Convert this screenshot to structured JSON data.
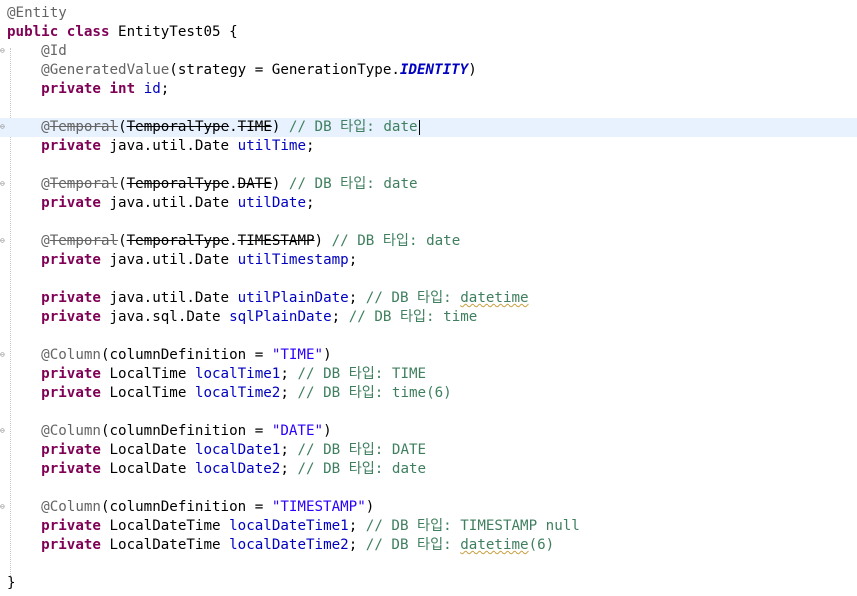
{
  "code": {
    "entity_annotation": "@Entity",
    "class_decl_kw": "public class",
    "class_name": "EntityTest05",
    "open_brace": " {",
    "close_brace": "}",
    "id_annotation": "@Id",
    "generated_value": "@GeneratedValue",
    "strategy_text": "(strategy = GenerationType.",
    "identity": "IDENTITY",
    "close_paren": ")",
    "private_kw": "private",
    "int_kw": "int",
    "id_field": "id",
    "semicolon": ";",
    "at_sign": "@",
    "temporal": "Temporal",
    "open_paren": "(",
    "temporal_type": "TemporalType",
    "dot": ".",
    "time_const": "TIME",
    "date_const": "DATE",
    "timestamp_const": "TIMESTAMP",
    "java_util_date": "java.util.Date",
    "java_sql_date": "java.sql.Date",
    "util_time": "utilTime",
    "util_date": "utilDate",
    "util_timestamp": "utilTimestamp",
    "util_plain_date": "utilPlainDate",
    "sql_plain_date": "sqlPlainDate",
    "column_annotation": "@Column",
    "column_def_prefix": "(columnDefinition = ",
    "time_str": "\"TIME\"",
    "date_str": "\"DATE\"",
    "timestamp_str": "\"TIMESTAMP\"",
    "local_time_type": "LocalTime",
    "local_date_type": "LocalDate",
    "local_datetime_type": "LocalDateTime",
    "local_time1": "localTime1",
    "local_time2": "localTime2",
    "local_date1": "localDate1",
    "local_date2": "localDate2",
    "local_datetime1": "localDateTime1",
    "local_datetime2": "localDateTime2",
    "comment_prefix": "// DB 타입: ",
    "c_date": "date",
    "c_datetime": "datetime",
    "c_time": "time",
    "c_TIME": "TIME",
    "c_time6": "time(6)",
    "c_DATE": "DATE",
    "c_timestamp_null": "TIMESTAMP null",
    "c_datetime6_word": "datetime",
    "c_datetime6_suffix": "(6)"
  },
  "colors": {
    "keyword": "#7f0055",
    "annotation": "#646464",
    "field": "#0000c0",
    "string": "#2a00ff",
    "comment": "#3f7f5f",
    "current_line": "#e8f2fe"
  }
}
